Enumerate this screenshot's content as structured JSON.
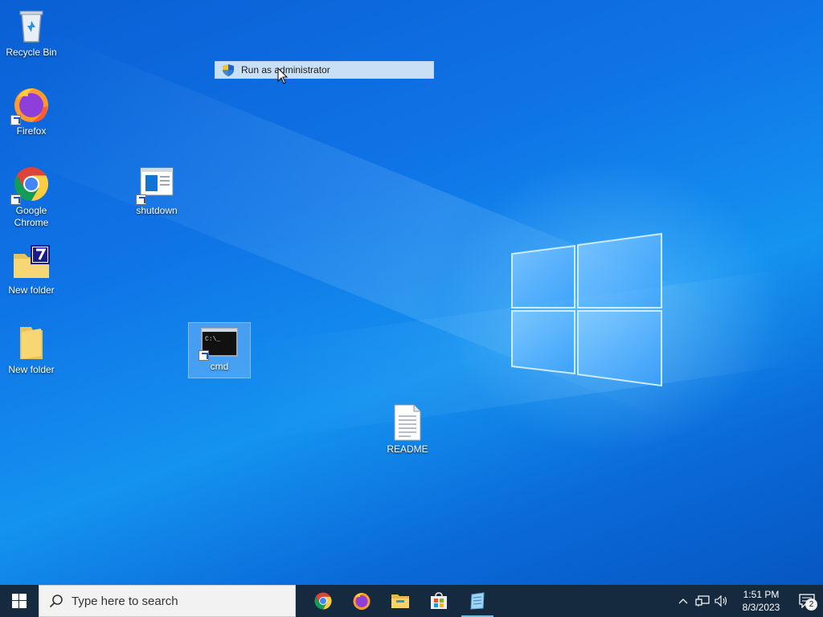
{
  "desktop": {
    "icons": [
      {
        "id": "recycle-bin",
        "label": "Recycle Bin",
        "icon": "recycle-bin-icon"
      },
      {
        "id": "firefox",
        "label": "Firefox",
        "icon": "firefox-icon"
      },
      {
        "id": "chrome",
        "label": "Google Chrome",
        "icon": "chrome-icon"
      },
      {
        "id": "new-folder-7zip",
        "label": "New folder",
        "icon": "folder-7zip-icon"
      },
      {
        "id": "new-folder",
        "label": "New folder",
        "icon": "folder-icon"
      },
      {
        "id": "shutdown",
        "label": "shutdown",
        "icon": "shutdown-icon"
      },
      {
        "id": "cmd",
        "label": "cmd",
        "icon": "cmd-icon",
        "selected": true
      },
      {
        "id": "readme",
        "label": "README",
        "icon": "text-file-icon"
      }
    ]
  },
  "context_menu": {
    "items": [
      {
        "label": "Run as administrator",
        "icon": "uac-shield-icon",
        "highlighted": true
      }
    ]
  },
  "taskbar": {
    "start_icon": "windows-start-icon",
    "search_placeholder": "Type here to search",
    "apps": [
      {
        "name": "Google Chrome",
        "icon": "chrome-icon"
      },
      {
        "name": "Firefox",
        "icon": "firefox-icon"
      },
      {
        "name": "File Explorer",
        "icon": "file-explorer-icon"
      },
      {
        "name": "Microsoft Store",
        "icon": "store-icon"
      },
      {
        "name": "Notepad",
        "icon": "notepad-icon",
        "active": true
      }
    ],
    "tray": {
      "icons": [
        "chevron-up-icon",
        "network-icon",
        "volume-icon"
      ],
      "time": "1:51 PM",
      "date": "8/3/2023",
      "notification_count": "2"
    }
  },
  "colors": {
    "desktop_blue": "#0f74e6",
    "taskbar": "#162a3f",
    "menu_highlight": "#c8e0f6"
  }
}
